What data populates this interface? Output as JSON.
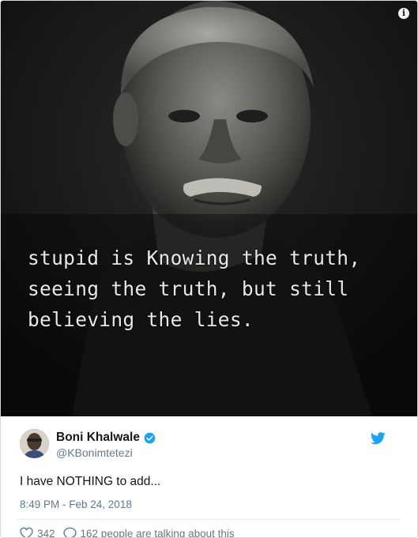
{
  "media": {
    "quote_lines": [
      "stupid is Knowing the truth,",
      "seeing the truth, but still",
      "believing the lies."
    ],
    "info_icon": "info-icon",
    "info_glyph": "i"
  },
  "tweet": {
    "author_name": "Boni Khalwale",
    "handle": "@KBonimtetezi",
    "text": "I have NOTHING to add...",
    "timestamp": "8:49 PM - Feb 24, 2018",
    "likes": "342",
    "replies_text": "162 people are talking about this",
    "verified_icon": "verified-badge-icon",
    "brand_icon": "twitter-bird-icon"
  },
  "colors": {
    "brand": "#1da1f2",
    "muted": "#657786",
    "text": "#14171a"
  }
}
